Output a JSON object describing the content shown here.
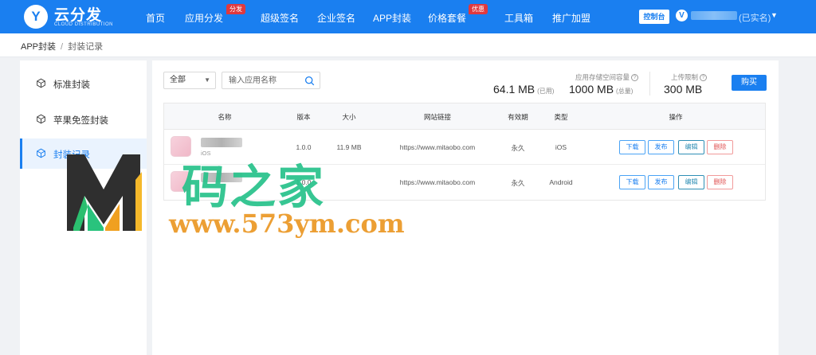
{
  "brand": {
    "logo_letter": "Y",
    "name": "云分发",
    "subtitle": "CLOUD DISTRIBUTION"
  },
  "nav": {
    "items": [
      "首页",
      "应用分发",
      "超级签名",
      "企业签名",
      "APP封装",
      "价格套餐",
      "工具箱",
      "推广加盟"
    ],
    "badges": {
      "app_dist": "分发",
      "pricing": "优惠"
    },
    "console": "控制台",
    "user_v": "V",
    "user_status": "(已实名)"
  },
  "breadcrumb": {
    "root": "APP封装",
    "sep": "/",
    "current": "封装记录"
  },
  "sidebar": {
    "items": [
      {
        "label": "标准封装"
      },
      {
        "label": "苹果免签封装"
      },
      {
        "label": "封装记录"
      }
    ]
  },
  "filters": {
    "select_value": "全部",
    "search_placeholder": "输入应用名称"
  },
  "stats": {
    "storage_label": "应用存储空间容量",
    "used": "64.1 MB",
    "used_sub": "(已用)",
    "total": "1000 MB",
    "total_sub": "(总量)",
    "upload_label": "上传限制",
    "upload_limit": "300 MB",
    "buy": "购买"
  },
  "table": {
    "headers": [
      "名称",
      "版本",
      "大小",
      "网站链接",
      "有效期",
      "类型",
      "操作"
    ],
    "rows": [
      {
        "platform": "iOS",
        "version": "1.0.0",
        "size": "11.9 MB",
        "url": "https://www.mitaobo.com",
        "validity": "永久",
        "type": "iOS"
      },
      {
        "platform": "",
        "version": "1.0.0",
        "size": "",
        "url": "https://www.mitaobo.com",
        "validity": "永久",
        "type": "Android"
      }
    ],
    "actions": {
      "download": "下载",
      "publish": "发布",
      "edit": "编辑",
      "delete": "删除"
    }
  },
  "watermark": {
    "cn": "码之家",
    "url": "www.573ym.com"
  },
  "colors": {
    "primary": "#1a7ff0",
    "danger": "#e05252",
    "wm_green": "#27c28a",
    "wm_orange": "#eb9a2a"
  }
}
